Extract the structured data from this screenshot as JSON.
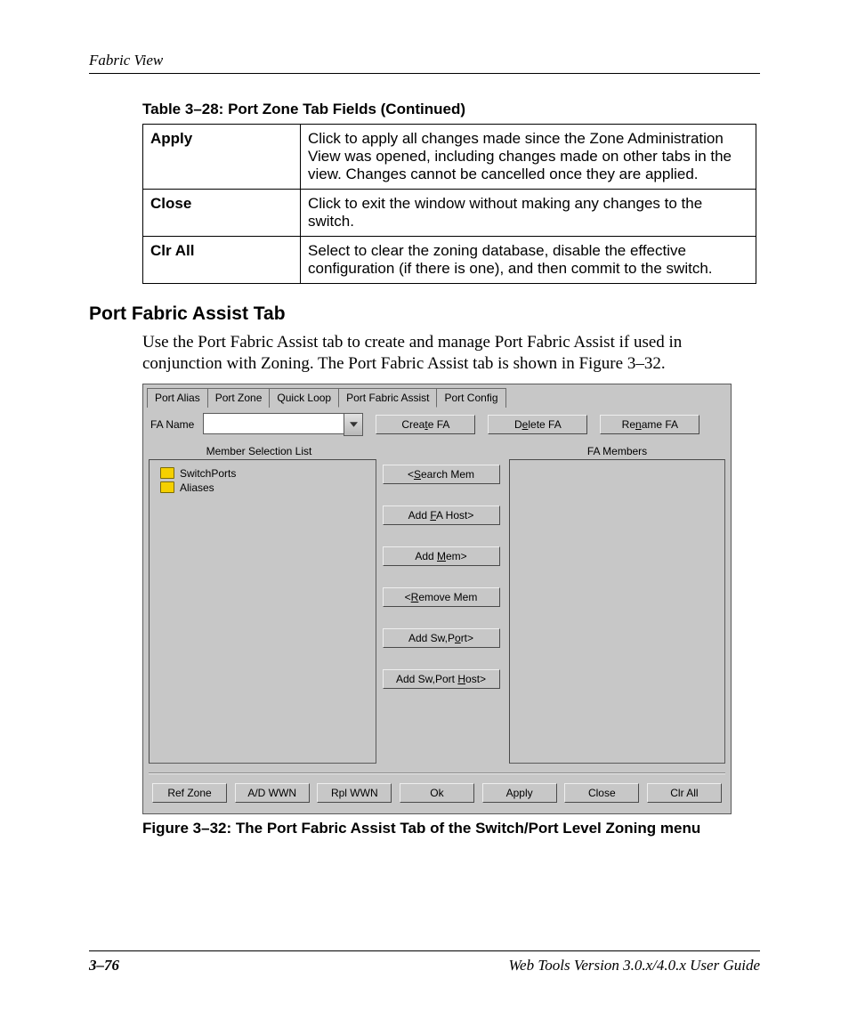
{
  "header": {
    "running": "Fabric View"
  },
  "table": {
    "caption": "Table 3–28:  Port Zone Tab Fields (Continued)",
    "rows": [
      {
        "k": "Apply",
        "v": "Click to apply all changes made since the Zone Administration View was opened, including changes made on other tabs in the view. Changes cannot be cancelled once they are applied."
      },
      {
        "k": "Close",
        "v": "Click to exit the window without making any changes to the switch."
      },
      {
        "k": "Clr All",
        "v": "Select to clear the zoning database, disable the effective configuration (if there is one), and then commit to the switch."
      }
    ]
  },
  "section": {
    "title": "Port Fabric Assist Tab",
    "body": "Use the Port Fabric Assist tab to create and manage Port Fabric Assist if used in conjunction with Zoning. The Port Fabric Assist tab is shown in Figure 3–32."
  },
  "ui": {
    "tabs": [
      "Port Alias",
      "Port Zone",
      "Quick Loop",
      "Port Fabric Assist",
      "Port Config"
    ],
    "activeTab": "Port Fabric Assist",
    "faLabel": "FA Name",
    "topButtons": {
      "create": "Create FA",
      "delete": "Delete FA",
      "rename": "Rename FA"
    },
    "colHeads": {
      "left": "Member Selection List",
      "right": "FA Members"
    },
    "tree": [
      "SwitchPorts",
      "Aliases"
    ],
    "midButtons": [
      "<Search Mem",
      "Add FA Host>",
      "Add Mem>",
      "<Remove Mem",
      "Add Sw,Port>",
      "Add Sw,Port Host>"
    ],
    "bottomButtons": [
      "Ref Zone",
      "A/D WWN",
      "Rpl WWN",
      "Ok",
      "Apply",
      "Close",
      "Clr All"
    ]
  },
  "figure": {
    "caption": "Figure 3–32:  The Port Fabric Assist Tab of the Switch/Port Level Zoning menu"
  },
  "footer": {
    "page": "3–76",
    "guide": "Web Tools Version 3.0.x/4.0.x User Guide"
  }
}
